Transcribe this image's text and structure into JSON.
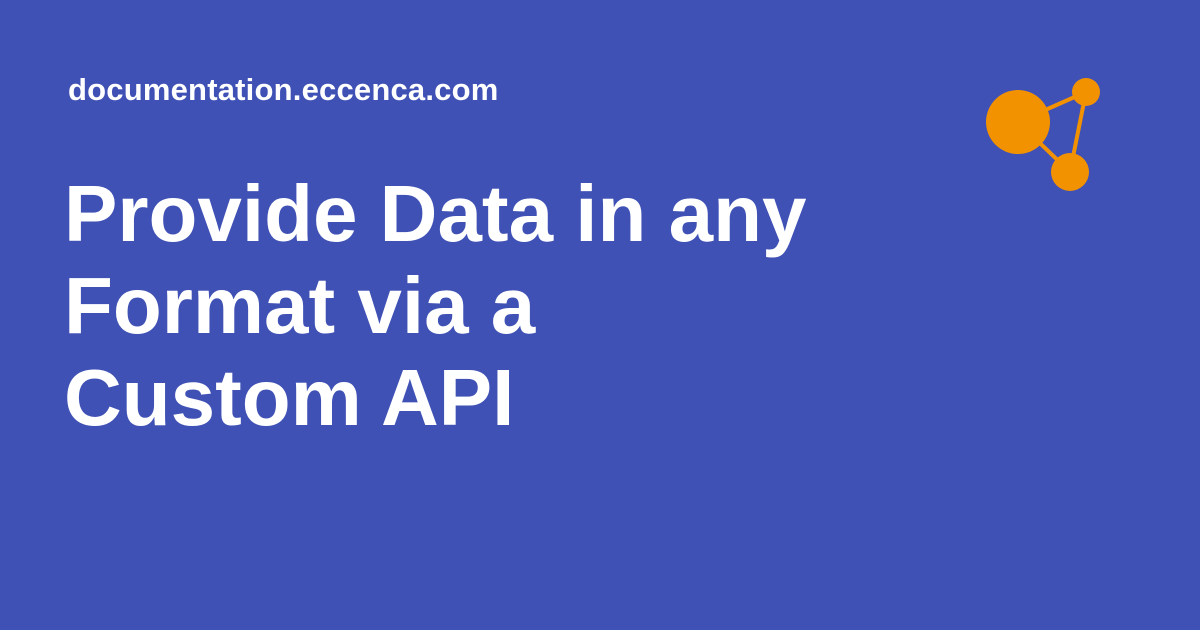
{
  "site": {
    "url": "documentation.eccenca.com"
  },
  "page": {
    "title_lines": [
      "Provide Data in any",
      "Format via a",
      "Custom API"
    ]
  },
  "logo": {
    "icon": "network-graph-icon",
    "color": "#f39200"
  },
  "theme": {
    "background": "#3f51b5",
    "text_color": "#ffffff"
  }
}
